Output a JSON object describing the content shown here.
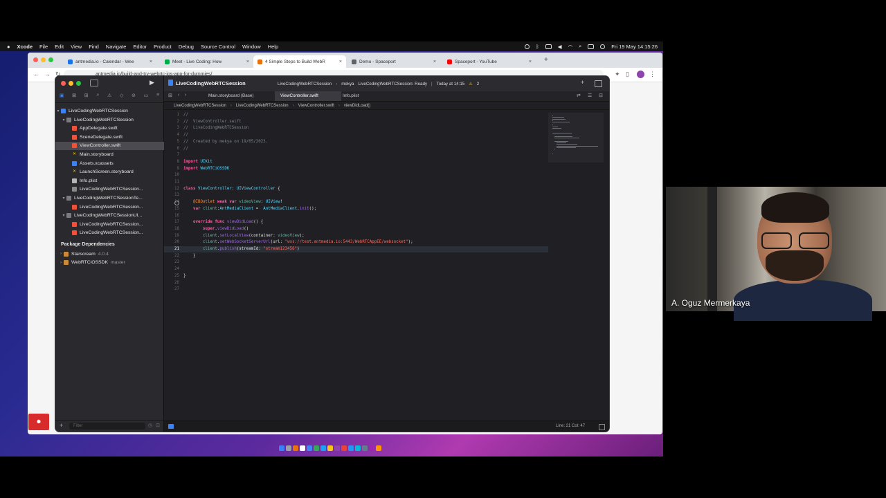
{
  "menubar": {
    "apple": "",
    "items": [
      "Xcode",
      "File",
      "Edit",
      "View",
      "Find",
      "Navigate",
      "Editor",
      "Product",
      "Debug",
      "Source Control",
      "Window",
      "Help"
    ],
    "datetime": "Fri 19 May  14:15:26"
  },
  "browser": {
    "tabs": [
      {
        "title": "antmedia.io - Calendar - Wee",
        "favicon_color": "#1a73e8"
      },
      {
        "title": "Meet - Live Coding: How",
        "favicon_color": "#00ac47"
      },
      {
        "title": "4 Simple Steps to Build WebR",
        "favicon_color": "#e8710a"
      },
      {
        "title": "Demo - Spaceport",
        "favicon_color": "#5f6368"
      },
      {
        "title": "Spaceport - YouTube",
        "favicon_color": "#ff0000"
      }
    ],
    "new_tab": "+",
    "url": "antmedia.io/build-and-try-webrtc-ios-app-for-dummies/",
    "record_icon": "record-icon"
  },
  "xcode": {
    "project_title": "LiveCodingWebRTCSession",
    "status": {
      "scheme": "LiveCodingWebRTCSession",
      "device": "mekya",
      "build": "LiveCodingWebRTCSession: Ready",
      "time": "Today at 14:15",
      "warnings": "2"
    },
    "navigator": {
      "root": "LiveCodingWebRTCSession",
      "items": [
        {
          "label": "LiveCodingWebRTCSession",
          "level": 1,
          "kind": "folder",
          "disc": "▾"
        },
        {
          "label": "AppDelegate.swift",
          "level": 2,
          "kind": "swift"
        },
        {
          "label": "SceneDelegate.swift",
          "level": 2,
          "kind": "swift"
        },
        {
          "label": "ViewController.swift",
          "level": 2,
          "kind": "swift",
          "selected": true
        },
        {
          "label": "Main.storyboard",
          "level": 2,
          "kind": "storyboard"
        },
        {
          "label": "Assets.xcassets",
          "level": 2,
          "kind": "assets"
        },
        {
          "label": "LaunchScreen.storyboard",
          "level": 2,
          "kind": "storyboard"
        },
        {
          "label": "Info.plist",
          "level": 2,
          "kind": "plist"
        },
        {
          "label": "LiveCodingWebRTCSession...",
          "level": 2,
          "kind": "file"
        },
        {
          "label": "LiveCodingWebRTCSessionTe...",
          "level": 1,
          "kind": "folder",
          "disc": "▾"
        },
        {
          "label": "LiveCodingWebRTCSession...",
          "level": 2,
          "kind": "swift"
        },
        {
          "label": "LiveCodingWebRTCSessionUI...",
          "level": 1,
          "kind": "folder",
          "disc": "▾"
        },
        {
          "label": "LiveCodingWebRTCSession...",
          "level": 2,
          "kind": "swift"
        },
        {
          "label": "LiveCodingWebRTCSession...",
          "level": 2,
          "kind": "swift"
        }
      ],
      "packages_header": "Package Dependencies",
      "packages": [
        {
          "name": "Starscream",
          "version": "4.0.4"
        },
        {
          "name": "WebRTCiOSSDK",
          "version": "master"
        }
      ],
      "filter_placeholder": "Filter"
    },
    "editor_tabs": [
      {
        "label": "Main.storyboard (Base)"
      },
      {
        "label": "ViewController.swift",
        "active": true
      },
      {
        "label": "Info.plist"
      }
    ],
    "jumpbar": [
      "LiveCodingWebRTCSession",
      "LiveCodingWebRTCSession",
      "ViewController.swift",
      "viewDidLoad()"
    ],
    "code_lines": [
      "//",
      "//  ViewController.swift",
      "//  LiveCodingWebRTCSession",
      "//",
      "//  Created by mekya on 19/05/2023.",
      "//",
      "",
      "import UIKit",
      "import WebRTCiOSSDK",
      "",
      "",
      "class ViewController: UIViewController {",
      "",
      "    @IBOutlet weak var videoView: UIView!",
      "    var client:AntMediaClient =  AntMediaClient.init();",
      "",
      "    override func viewDidLoad() {",
      "        super.viewDidLoad()",
      "        client.setLocalView(container: videoView);",
      "        client.setWebSocketServerUrl(url: \"wss://test.antmedia.io:5443/WebRTCAppEE/websocket\");",
      "        client.publish(streamId: \"stream123456\")",
      "    }",
      "",
      "",
      "}",
      "",
      ""
    ],
    "cursor_line": 21,
    "cursor_status": "Line: 21  Col: 47"
  },
  "webcam": {
    "participant_name": "A. Oguz Mermerkaya"
  }
}
